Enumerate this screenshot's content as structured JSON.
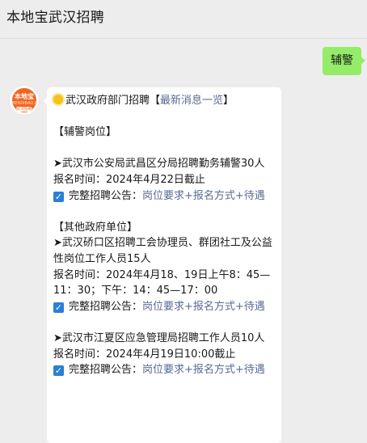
{
  "header": {
    "title": "本地宝武汉招聘",
    "menu_icon": "more-icon"
  },
  "sent_message": {
    "text": "辅警"
  },
  "avatar": {
    "brand": "本地宝",
    "sub": "BENDIBAO.COM",
    "city": "武汉招聘"
  },
  "reply": {
    "title_prefix": "武汉政府部门招聘【",
    "title_link": "最新消息一览",
    "title_suffix": "】",
    "section1": "【辅警岗位】",
    "job1": {
      "title": "➤武汉市公安局武昌区分局招聘勤务辅警30人",
      "deadline": "报名时间：2024年4月22日截止",
      "notice_label": "完整招聘公告：",
      "notice_link": "岗位要求+报名方式+待遇"
    },
    "section2": "【其他政府单位】",
    "job2": {
      "title": "➤武汉硚口区招聘工会协理员、群团社工及公益性岗位工作人员15人",
      "deadline": "报名时间：2024年4月18、19日上午8：45—11：30；下午：14：45—17：00",
      "notice_label": "完整招聘公告：",
      "notice_link": "岗位要求+报名方式+待遇"
    },
    "job3": {
      "title": "➤武汉市江夏区应急管理局招聘工作人员10人",
      "deadline": "报名时间：2024年4月19日10:00截止",
      "notice_label": "完整招聘公告：",
      "notice_link": "岗位要求+报名方式+待遇"
    }
  },
  "colors": {
    "bg": "#ededed",
    "my_bubble": "#95ec69",
    "link": "#576b95",
    "checkbox": "#2a7fd4",
    "avatar": "#f5641e"
  }
}
